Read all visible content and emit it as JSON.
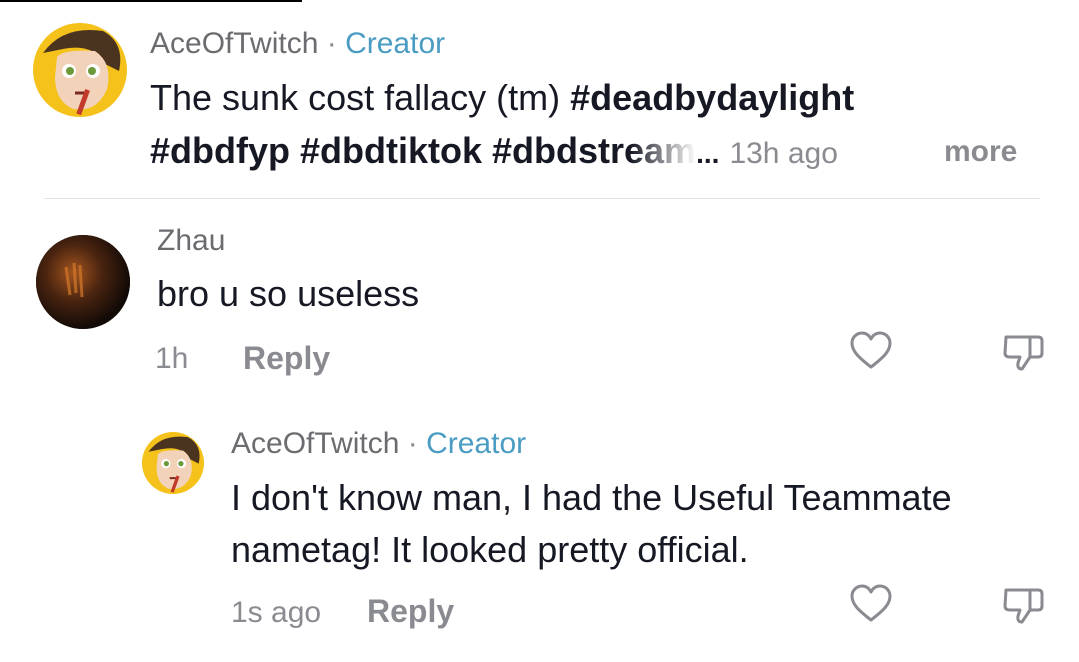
{
  "creator_post": {
    "username": "AceOfTwitch",
    "separator": "·",
    "badge": "Creator",
    "caption_text": "The sunk cost fallacy (tm)",
    "hashtags_line1": "#deadbydaylight",
    "hashtags_line2": "#dbdfyp #dbdtiktok #dbdstream",
    "truncation": "...",
    "time": "13h ago",
    "more_label": "more"
  },
  "comments": [
    {
      "username": "Zhau",
      "text": "bro u so useless",
      "time": "1h",
      "reply_label": "Reply"
    }
  ],
  "replies": [
    {
      "username": "AceOfTwitch",
      "separator": "·",
      "badge": "Creator",
      "text_line1": "I don't know man, I had the Useful Teammate",
      "text_line2": "nametag! It looked pretty official.",
      "time": "1s ago",
      "reply_label": "Reply"
    }
  ],
  "icons": {
    "like": "heart-outline-icon",
    "dislike": "thumbs-down-outline-icon"
  },
  "colors": {
    "creator_badge": "#4a9cc3",
    "muted_text": "#8a8b91",
    "primary_text": "#161823"
  }
}
